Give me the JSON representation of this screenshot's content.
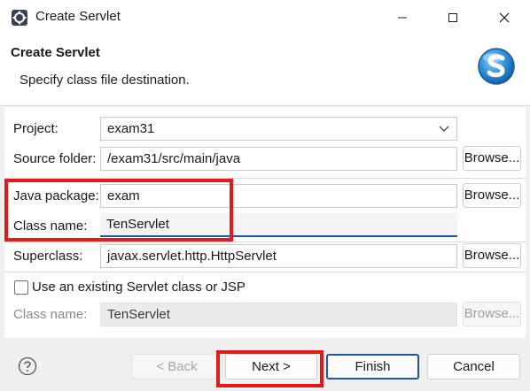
{
  "window": {
    "title": "Create Servlet",
    "app_icon": "eclipse-gear-icon",
    "controls": [
      "minimize-icon",
      "maximize-icon",
      "close-icon"
    ]
  },
  "banner": {
    "title": "Create Servlet",
    "description": "Specify class file destination.",
    "logo": "servlet-s-logo"
  },
  "form": {
    "project": {
      "label": "Project:",
      "value": "exam31"
    },
    "source_folder": {
      "label": "Source folder:",
      "value": "/exam31/src/main/java",
      "browse": "Browse..."
    },
    "java_package": {
      "label": "Java package:",
      "value": "exam",
      "browse": "Browse..."
    },
    "class_name": {
      "label": "Class name:",
      "value": "TenServlet"
    },
    "superclass": {
      "label": "Superclass:",
      "value": "javax.servlet.http.HttpServlet",
      "browse": "Browse..."
    },
    "use_existing": {
      "label": "Use an existing Servlet class or JSP",
      "checked": false
    },
    "existing_class": {
      "label": "Class name:",
      "value": "TenServlet",
      "browse": "Browse..."
    }
  },
  "footer": {
    "help_icon": "help-question-icon",
    "back": "< Back",
    "next": "Next >",
    "finish": "Finish",
    "cancel": "Cancel"
  },
  "colors": {
    "highlight": "#e01b1b",
    "focus_accent": "#1a56b0",
    "logo_blue": "#2a8fd6"
  }
}
